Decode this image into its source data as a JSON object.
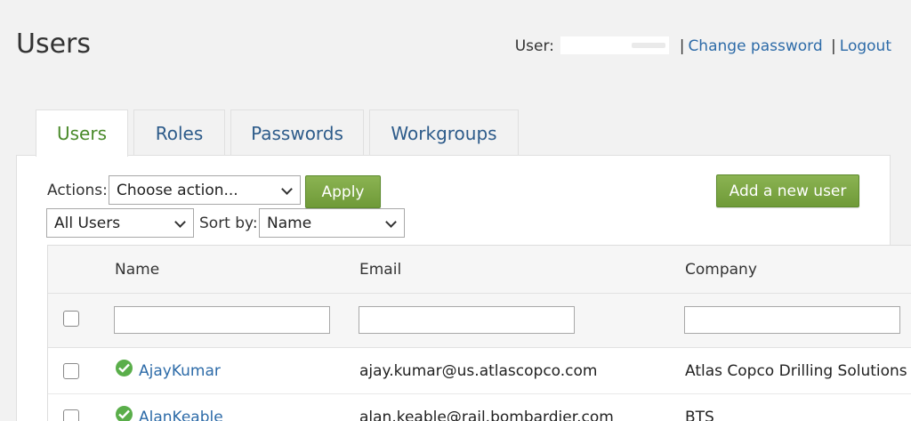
{
  "page": {
    "title": "Users"
  },
  "user_bar": {
    "label": "User:",
    "change_password": "Change password",
    "separator": "|",
    "logout": "Logout"
  },
  "tabs": [
    {
      "label": "Users",
      "active": true
    },
    {
      "label": "Roles",
      "active": false
    },
    {
      "label": "Passwords",
      "active": false
    },
    {
      "label": "Workgroups",
      "active": false
    }
  ],
  "toolbar": {
    "actions_label": "Actions:",
    "action_selected": "Choose action...",
    "apply_label": "Apply",
    "add_user_label": "Add a new user",
    "filter_selected": "All Users",
    "sort_label": "Sort by:",
    "sort_selected": "Name"
  },
  "table": {
    "columns": [
      "Name",
      "Email",
      "Company"
    ],
    "rows": [
      {
        "name": "AjayKumar",
        "email": "ajay.kumar@us.atlascopco.com",
        "company": "Atlas Copco Drilling Solutions",
        "status": "active"
      },
      {
        "name": "AlanKeable",
        "email": "alan.keable@rail.bombardier.com",
        "company": "BTS",
        "status": "active"
      }
    ]
  },
  "colors": {
    "accent_green": "#6f9a38",
    "link_blue": "#2d6ba8",
    "active_tab_green": "#4a8a2a",
    "status_green": "#5aae4a"
  }
}
